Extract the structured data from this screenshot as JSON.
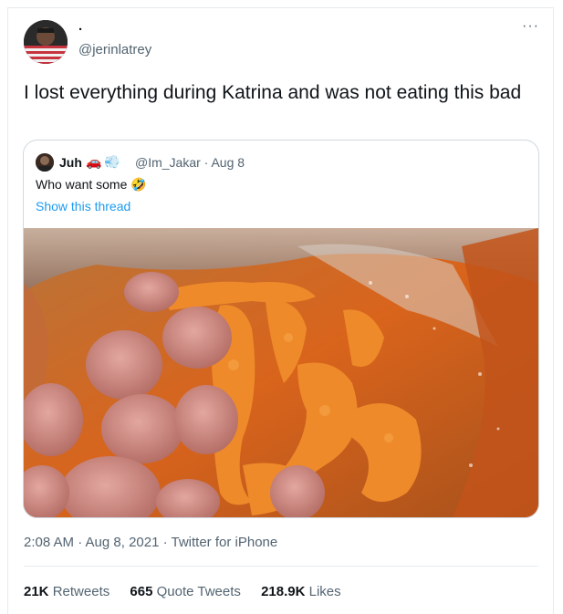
{
  "author": {
    "display_name": ".",
    "handle": "@jerinlatrey",
    "more_icon": "more-horizontal-icon"
  },
  "tweet": {
    "text": "I lost everything during Katrina and was not eating this bad",
    "timestamp": "2:08 AM · Aug 8, 2021 · Twitter for iPhone"
  },
  "quoted_tweet": {
    "display_name": "Juh",
    "emojis": [
      "🚗",
      "💨"
    ],
    "handle_date": "@Im_Jakar · Aug 8",
    "text": "Who want some 🤣",
    "show_thread": "Show this thread",
    "image_description_icon": "photo-hotdogs-cheetos"
  },
  "stats": {
    "retweets_count": "21K",
    "retweets_label": "Retweets",
    "quotes_count": "665",
    "quotes_label": "Quote Tweets",
    "likes_count": "218.9K",
    "likes_label": "Likes"
  },
  "colors": {
    "link": "#1d9bf0",
    "secondary_text": "#536471",
    "border": "#e6ecf0"
  }
}
